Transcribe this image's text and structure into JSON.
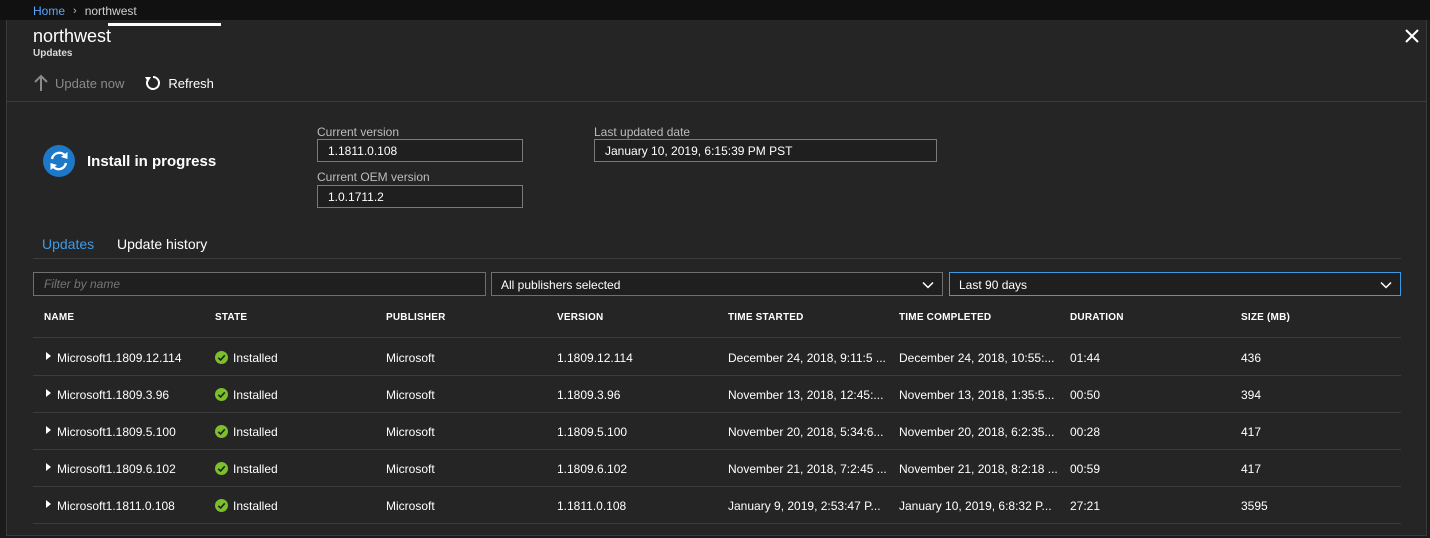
{
  "breadcrumb": {
    "home": "Home",
    "separator": "›",
    "current": "northwest"
  },
  "blade": {
    "title": "northwest",
    "subtitle": "Updates"
  },
  "toolbar": {
    "update_now": "Update now",
    "refresh": "Refresh"
  },
  "status": {
    "label": "Install in progress",
    "icon": "sync-icon",
    "icon_color": "#1e78c8"
  },
  "fields": {
    "current_version_label": "Current version",
    "current_version_value": "1.1811.0.108",
    "oem_version_label": "Current OEM version",
    "oem_version_value": "1.0.1711.2",
    "last_updated_label": "Last updated date",
    "last_updated_value": "January 10, 2019, 6:15:39 PM PST"
  },
  "tabs": [
    {
      "label": "Updates",
      "active": false
    },
    {
      "label": "Update history",
      "active": true
    }
  ],
  "filters": {
    "name_placeholder": "Filter by name",
    "publishers": "All publishers selected",
    "timespan": "Last 90 days"
  },
  "table": {
    "columns": [
      "NAME",
      "STATE",
      "PUBLISHER",
      "VERSION",
      "TIME STARTED",
      "TIME COMPLETED",
      "DURATION",
      "SIZE (MB)"
    ],
    "rows": [
      {
        "name": "Microsoft1.1809.12.114",
        "state": "Installed",
        "publisher": "Microsoft",
        "version": "1.1809.12.114",
        "started": "December 24, 2018, 9:11:5 ...",
        "completed": "December 24, 2018, 10:55:...",
        "duration": "01:44",
        "size": "436"
      },
      {
        "name": "Microsoft1.1809.3.96",
        "state": "Installed",
        "publisher": "Microsoft",
        "version": "1.1809.3.96",
        "started": "November 13, 2018, 12:45:...",
        "completed": "November 13, 2018, 1:35:5...",
        "duration": "00:50",
        "size": "394"
      },
      {
        "name": "Microsoft1.1809.5.100",
        "state": "Installed",
        "publisher": "Microsoft",
        "version": "1.1809.5.100",
        "started": "November 20, 2018, 5:34:6...",
        "completed": "November 20, 2018, 6:2:35...",
        "duration": "00:28",
        "size": "417"
      },
      {
        "name": "Microsoft1.1809.6.102",
        "state": "Installed",
        "publisher": "Microsoft",
        "version": "1.1809.6.102",
        "started": "November 21, 2018, 7:2:45 ...",
        "completed": "November 21, 2018, 8:2:18 ...",
        "duration": "00:59",
        "size": "417"
      },
      {
        "name": "Microsoft1.1811.0.108",
        "state": "Installed",
        "publisher": "Microsoft",
        "version": "1.1811.0.108",
        "started": "January 9, 2019, 2:53:47 P...",
        "completed": "January 10, 2019, 6:8:32 P...",
        "duration": "27:21",
        "size": "3595"
      }
    ]
  },
  "colors": {
    "accent": "#3f9ae4",
    "installed": "#7bbf2a"
  }
}
